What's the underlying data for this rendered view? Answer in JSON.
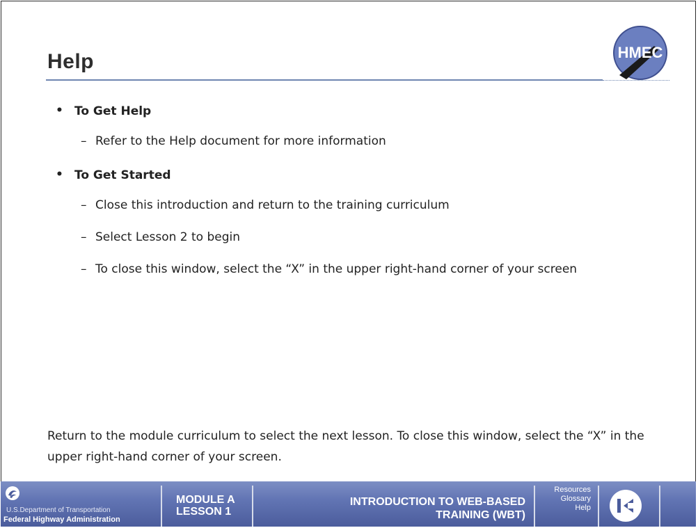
{
  "page": {
    "title": "Help"
  },
  "logo": {
    "text": "HMEC",
    "colors": {
      "circle": "#6b7fc0",
      "border": "#3f4f8f",
      "slash": "#1a1a1a"
    }
  },
  "sections": [
    {
      "heading": "To Get Help",
      "items": [
        "Refer to the Help document for more information"
      ]
    },
    {
      "heading": "To Get Started",
      "items": [
        "Close this introduction and return to the training curriculum",
        "Select Lesson 2 to begin",
        "To close this window, select the “X” in the upper right-hand corner of your screen"
      ]
    }
  ],
  "markers": {
    "bullet": "•",
    "dash": "–"
  },
  "footer_note": "Return to the module curriculum to select the next lesson. To close this window, select the “X” in the upper right-hand corner of your screen.",
  "bottom_bar": {
    "agency_line1": "U.S.Department of Transportation",
    "agency_line2": "Federal Highway Administration",
    "module_line1": "MODULE A",
    "module_line2": "LESSON 1",
    "course_line1": "INTRODUCTION TO WEB-BASED",
    "course_line2": "TRAINING (WBT)",
    "links": [
      "Resources",
      "Glossary",
      "Help"
    ],
    "nav_icon": "back-arrow-icon",
    "colors": {
      "bar_top": "#7d8fc4",
      "bar_bottom": "#4b5c9c",
      "divider": "#d7dcea",
      "nav_icon": "#4b5c9c"
    }
  }
}
